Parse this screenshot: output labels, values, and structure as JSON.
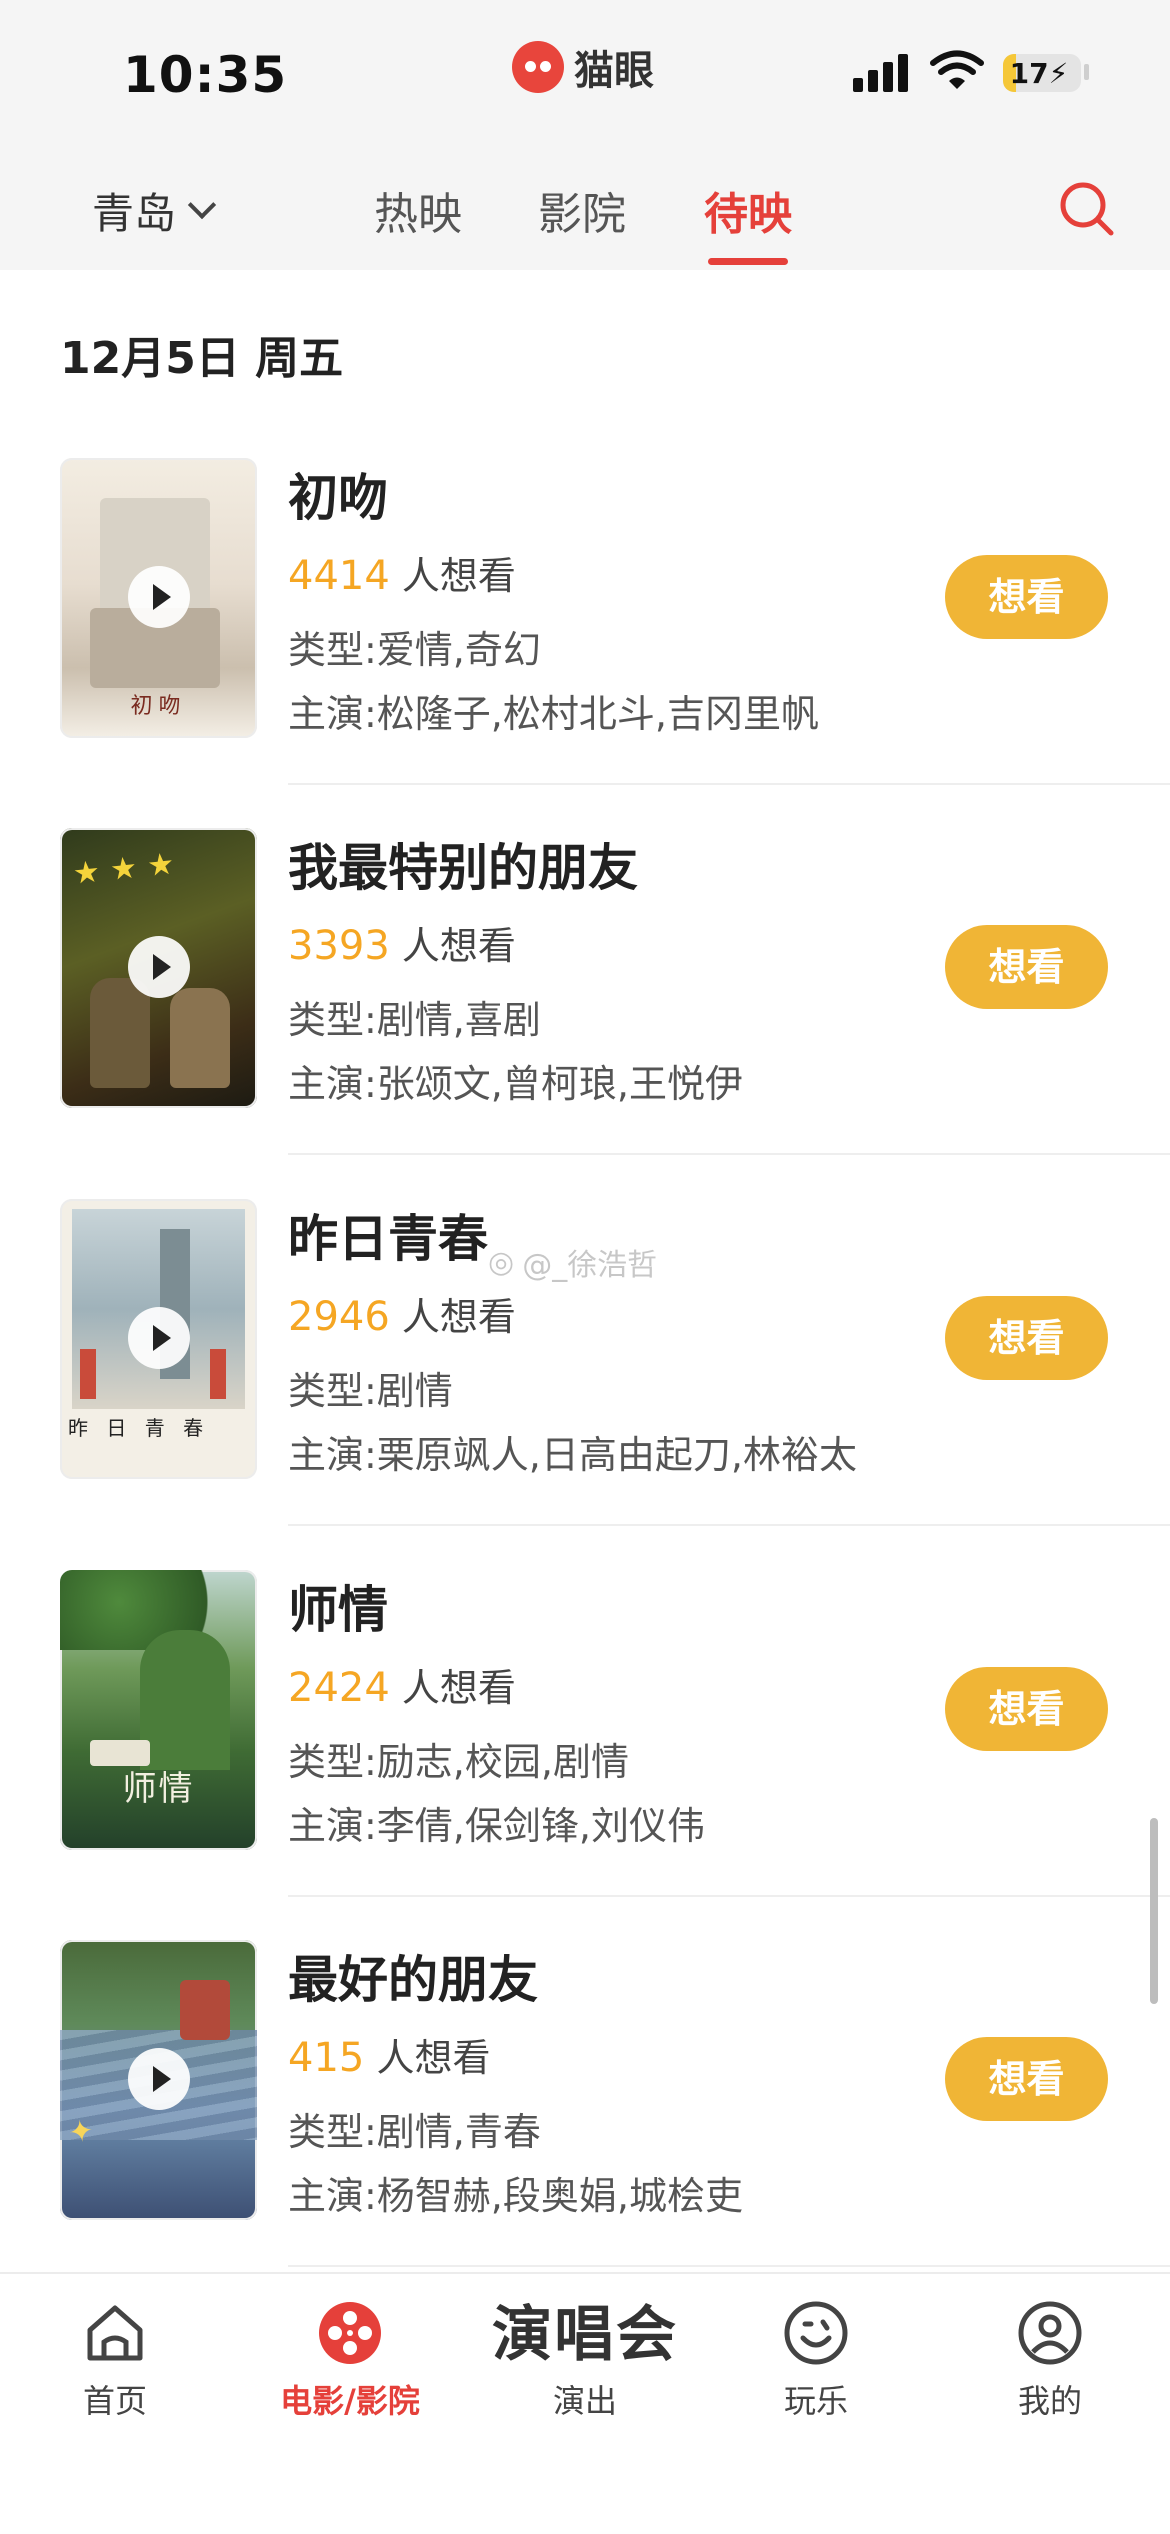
{
  "status_bar": {
    "time": "10:35",
    "battery": "17",
    "battery_level": 0.17
  },
  "app": {
    "brand": "猫眼"
  },
  "header": {
    "city": "青岛",
    "tabs": [
      {
        "label": "热映"
      },
      {
        "label": "影院"
      },
      {
        "label": "待映"
      }
    ]
  },
  "date_heading": "12月5日 周五",
  "movies": [
    {
      "title": "初吻",
      "want_count": "4414",
      "want_suffix": "人想看",
      "genre": "类型:爱情,奇幻",
      "cast": "主演:松隆子,松村北斗,吉冈里帆",
      "poster_caption": "初吻",
      "button": "想看"
    },
    {
      "title": "我最特别的朋友",
      "want_count": "3393",
      "want_suffix": "人想看",
      "genre": "类型:剧情,喜剧",
      "cast": "主演:张颂文,曾柯琅,王悦伊",
      "poster_caption": "",
      "button": "想看"
    },
    {
      "title": "昨日青春",
      "want_count": "2946",
      "want_suffix": "人想看",
      "genre": "类型:剧情",
      "cast": "主演:栗原飒人,日高由起刀,林裕太",
      "poster_caption": "昨 日 青 春",
      "button": "想看"
    },
    {
      "title": "师情",
      "want_count": "2424",
      "want_suffix": "人想看",
      "genre": "类型:励志,校园,剧情",
      "cast": "主演:李倩,保剑锋,刘仪伟",
      "poster_caption": "师情",
      "button": "想看"
    },
    {
      "title": "最好的朋友",
      "want_count": "415",
      "want_suffix": "人想看",
      "genre": "类型:剧情,青春",
      "cast": "主演:杨智赫,段奥娟,城桧吏",
      "poster_caption": "",
      "button": "想看"
    }
  ],
  "watermark": "@_徐浩哲",
  "bottom_nav": {
    "home": "首页",
    "movies": "电影/影院",
    "concert_big": "演唱会",
    "concert": "演出",
    "fun": "玩乐",
    "mine": "我的"
  },
  "colors": {
    "accent": "#e5403a",
    "button": "#f0b536",
    "want_number": "#f5a623"
  }
}
